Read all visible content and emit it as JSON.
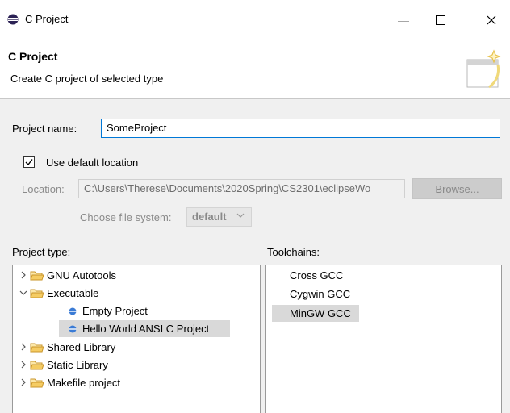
{
  "window": {
    "title": "C Project"
  },
  "header": {
    "title": "C Project",
    "subtitle": "Create C project of selected type"
  },
  "form": {
    "project_name_label": "Project name:",
    "project_name_value": "SomeProject",
    "use_default_label": "Use default location",
    "use_default_checked": true,
    "location_label": "Location:",
    "location_value": "C:\\Users\\Therese\\Documents\\2020Spring\\CS2301\\eclipseWo",
    "browse_label": "Browse...",
    "file_system_label": "Choose file system:",
    "file_system_value": "default"
  },
  "project_type": {
    "label": "Project type:",
    "items": [
      {
        "label": "GNU Autotools",
        "kind": "folder",
        "expanded": false
      },
      {
        "label": "Executable",
        "kind": "folder",
        "expanded": true
      },
      {
        "label": "Empty Project",
        "kind": "project"
      },
      {
        "label": "Hello World ANSI C Project",
        "kind": "project",
        "selected": true
      },
      {
        "label": "Shared Library",
        "kind": "folder",
        "expanded": false
      },
      {
        "label": "Static Library",
        "kind": "folder",
        "expanded": false
      },
      {
        "label": "Makefile project",
        "kind": "folder",
        "expanded": false
      }
    ]
  },
  "toolchains": {
    "label": "Toolchains:",
    "items": [
      {
        "label": "Cross GCC"
      },
      {
        "label": "Cygwin GCC"
      },
      {
        "label": "MinGW GCC",
        "selected": true
      }
    ]
  },
  "colors": {
    "accent": "#0078d7",
    "selection": "#d9d9d9",
    "folder": "#e6b84a",
    "bullet": "#2f6fc0"
  }
}
